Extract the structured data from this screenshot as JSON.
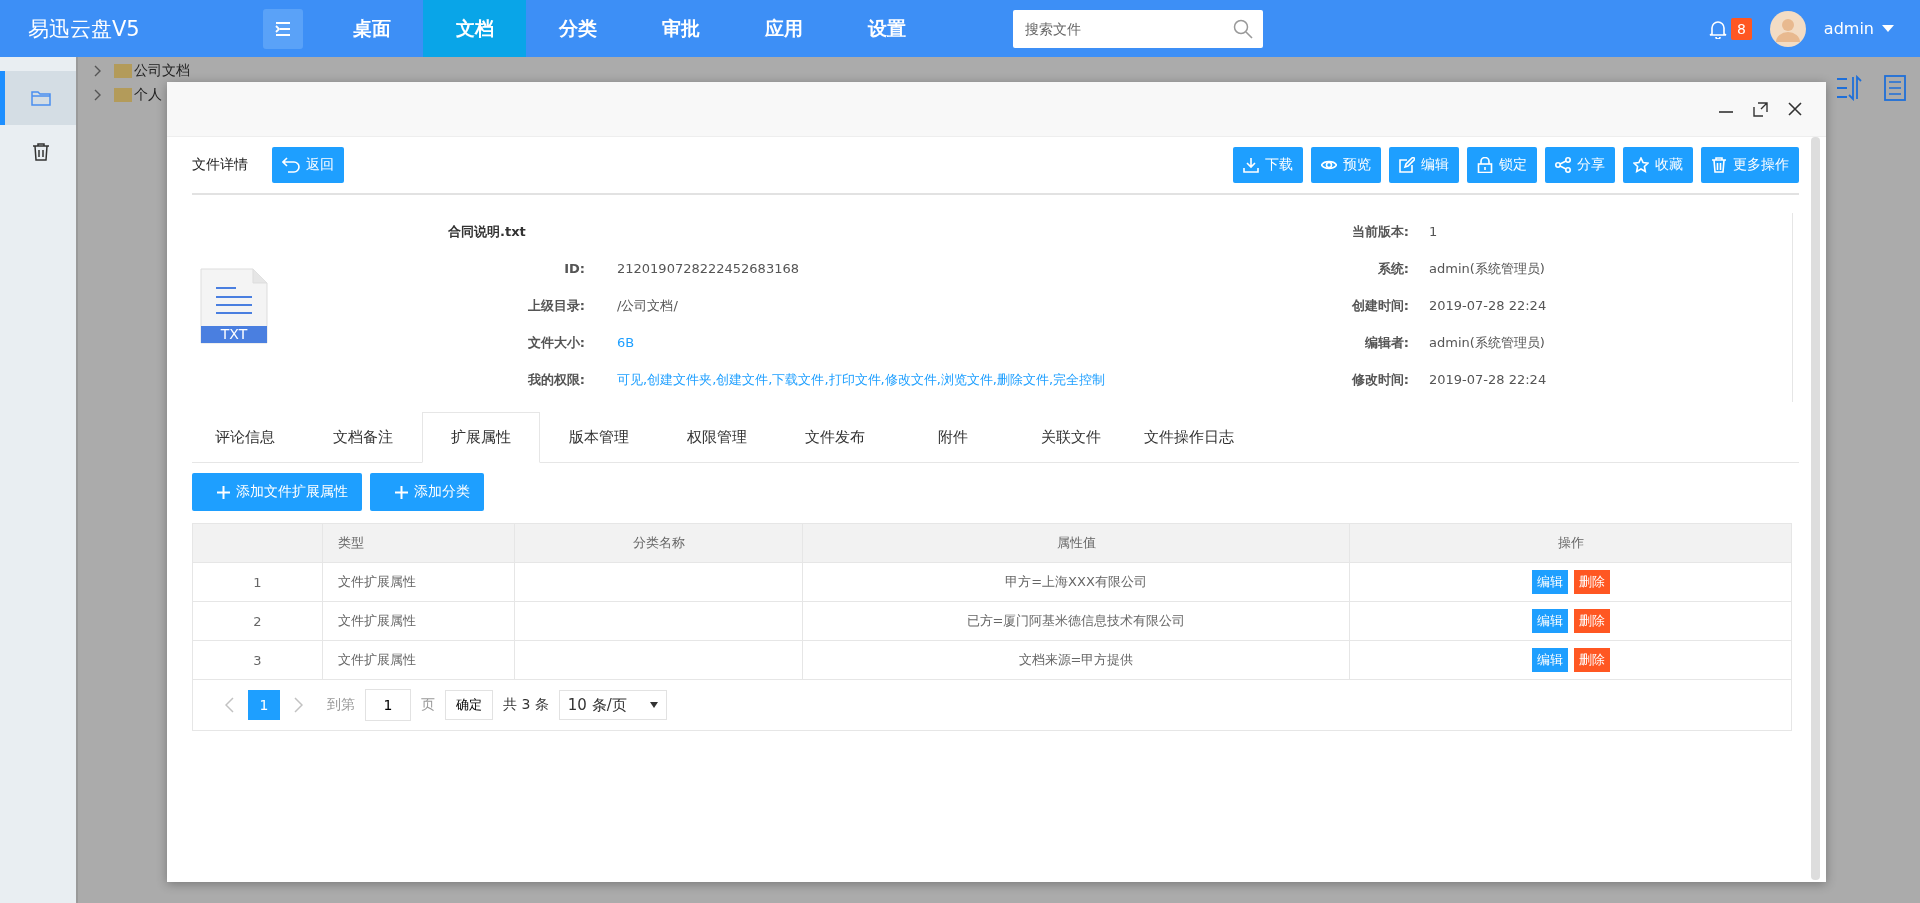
{
  "app": {
    "logo": "易迅云盘V5"
  },
  "nav": [
    {
      "label": "桌面",
      "selected": false
    },
    {
      "label": "文档",
      "selected": true
    },
    {
      "label": "分类",
      "selected": false
    },
    {
      "label": "审批",
      "selected": false
    },
    {
      "label": "应用",
      "selected": false
    },
    {
      "label": "设置",
      "selected": false
    }
  ],
  "search": {
    "placeholder": "搜索文件"
  },
  "notifications": {
    "count": "8"
  },
  "user": {
    "name": "admin"
  },
  "sidebar": {
    "items": [
      {
        "kind": "folder",
        "selected": true
      },
      {
        "kind": "trash",
        "selected": false
      }
    ]
  },
  "tree": [
    {
      "label": "公司文档"
    },
    {
      "label": "个人"
    }
  ],
  "dialog": {
    "heading": "文件详情",
    "back_button": "返回",
    "actions": [
      {
        "kind": "download",
        "label": "下载"
      },
      {
        "kind": "preview",
        "label": "预览"
      },
      {
        "kind": "edit",
        "label": "编辑"
      },
      {
        "kind": "lock",
        "label": "锁定"
      },
      {
        "kind": "share",
        "label": "分享"
      },
      {
        "kind": "favorite",
        "label": "收藏"
      },
      {
        "kind": "more",
        "label": "更多操作"
      }
    ],
    "file": {
      "name": "合同说明.txt",
      "type_badge": "TXT",
      "left_fields": [
        {
          "label": "ID:",
          "value": "2120190728222452683168",
          "kind": "text"
        },
        {
          "label": "上级目录:",
          "value": "/公司文档/",
          "kind": "text"
        },
        {
          "label": "文件大小:",
          "value": "6B",
          "kind": "link"
        },
        {
          "label": "我的权限:",
          "value": "可见,创建文件夹,创建文件,下载文件,打印文件,修改文件,浏览文件,删除文件,完全控制",
          "kind": "link"
        }
      ],
      "right_fields": [
        {
          "label": "当前版本:",
          "value": "1"
        },
        {
          "label": "系统:",
          "value": "admin(系统管理员)"
        },
        {
          "label": "创建时间:",
          "value": "2019-07-28 22:24"
        },
        {
          "label": "编辑者:",
          "value": "admin(系统管理员)"
        },
        {
          "label": "修改时间:",
          "value": "2019-07-28 22:24"
        }
      ]
    },
    "tabs": [
      {
        "label": "评论信息",
        "selected": false
      },
      {
        "label": "文档备注",
        "selected": false
      },
      {
        "label": "扩展属性",
        "selected": true
      },
      {
        "label": "版本管理",
        "selected": false
      },
      {
        "label": "权限管理",
        "selected": false
      },
      {
        "label": "文件发布",
        "selected": false
      },
      {
        "label": "附件",
        "selected": false
      },
      {
        "label": "关联文件",
        "selected": false
      },
      {
        "label": "文件操作日志",
        "selected": false
      }
    ],
    "add_buttons": [
      "添加文件扩展属性",
      "添加分类"
    ],
    "table": {
      "columns": [
        "类型",
        "分类名称",
        "属性值",
        "操作"
      ],
      "rows": [
        {
          "index": "1",
          "type": "文件扩展属性",
          "value": "甲方=上海XXX有限公司",
          "actions": [
            {
              "kind": "edit",
              "label": "编辑"
            },
            {
              "kind": "delete",
              "label": "删除"
            }
          ]
        },
        {
          "index": "2",
          "type": "文件扩展属性",
          "value": "已方=厦门阿基米德信息技术有限公司",
          "actions": [
            {
              "kind": "edit",
              "label": "编辑"
            },
            {
              "kind": "delete",
              "label": "删除"
            }
          ]
        },
        {
          "index": "3",
          "type": "文件扩展属性",
          "value": "文档来源=甲方提供",
          "actions": [
            {
              "kind": "edit",
              "label": "编辑"
            },
            {
              "kind": "delete",
              "label": "删除"
            }
          ]
        }
      ]
    },
    "pagination": {
      "pages": [
        {
          "label": "1",
          "selected": true
        }
      ],
      "goto_label": "到第",
      "goto_value": "1",
      "page_unit": "页",
      "confirm": "确定",
      "total": "共 3 条",
      "page_size": "10 条/页"
    }
  }
}
